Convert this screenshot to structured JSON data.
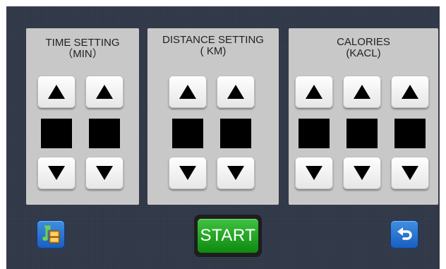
{
  "panels": {
    "time": {
      "title_line1": "TIME SETTING",
      "title_line2": "（MIN）"
    },
    "distance": {
      "title_line1": "DISTANCE SETTING",
      "title_line2": "( KM)"
    },
    "calories": {
      "title_line1": "CALORIES",
      "title_line2": "(KACL)"
    }
  },
  "footer": {
    "start_label": "START",
    "left_icon": "music-video-icon",
    "right_icon": "back-arrow-icon"
  },
  "colors": {
    "background": "#2f3645",
    "panel": "#c8c8c8",
    "digit": "#000000",
    "start": "#1f9e1f",
    "icon_button": "#2a78d6"
  }
}
